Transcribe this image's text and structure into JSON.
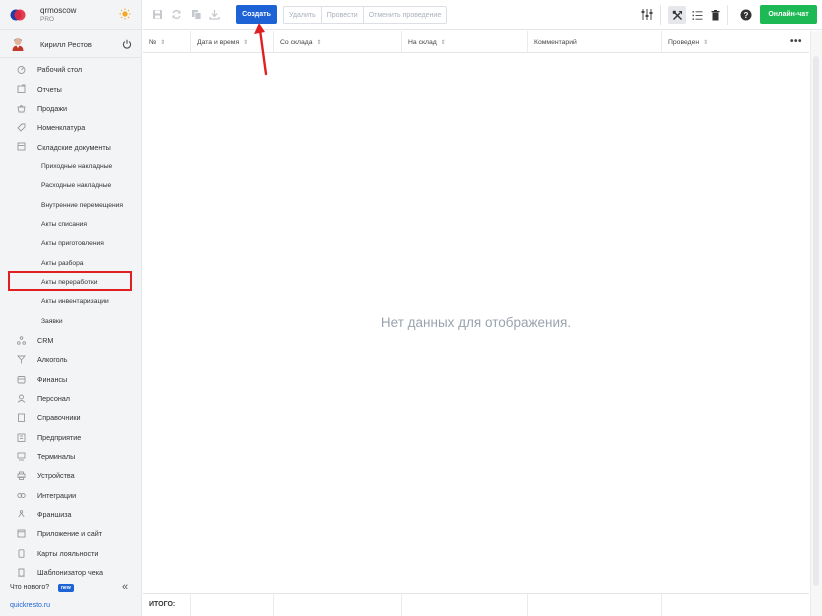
{
  "brand": {
    "name": "qrmoscow",
    "plan": "PRO"
  },
  "user": {
    "name": "Кирилл Рестов"
  },
  "nav": [
    {
      "label": "Рабочий стол",
      "icon": "dashboard-icon",
      "sub": false
    },
    {
      "label": "Отчеты",
      "icon": "reports-icon",
      "sub": false
    },
    {
      "label": "Продажи",
      "icon": "sales-icon",
      "sub": false
    },
    {
      "label": "Номенклатура",
      "icon": "tag-icon",
      "sub": false
    },
    {
      "label": "Складские документы",
      "icon": "warehouse-icon",
      "sub": false
    },
    {
      "label": "Приходные накладные",
      "sub": true
    },
    {
      "label": "Расходные накладные",
      "sub": true
    },
    {
      "label": "Внутренние перемещения",
      "sub": true
    },
    {
      "label": "Акты списания",
      "sub": true
    },
    {
      "label": "Акты приготовления",
      "sub": true
    },
    {
      "label": "Акты разбора",
      "sub": true
    },
    {
      "label": "Акты переработки",
      "sub": true,
      "active": true
    },
    {
      "label": "Акты инвентаризации",
      "sub": true
    },
    {
      "label": "Заявки",
      "sub": true
    },
    {
      "label": "CRM",
      "icon": "crm-icon",
      "sub": false
    },
    {
      "label": "Алкоголь",
      "icon": "alcohol-icon",
      "sub": false
    },
    {
      "label": "Финансы",
      "icon": "finance-icon",
      "sub": false
    },
    {
      "label": "Персонал",
      "icon": "staff-icon",
      "sub": false
    },
    {
      "label": "Справочники",
      "icon": "book-icon",
      "sub": false
    },
    {
      "label": "Предприятие",
      "icon": "building-icon",
      "sub": false
    },
    {
      "label": "Терминалы",
      "icon": "terminal-icon",
      "sub": false
    },
    {
      "label": "Устройства",
      "icon": "printer-icon",
      "sub": false
    },
    {
      "label": "Интеграции",
      "icon": "link-icon",
      "sub": false
    },
    {
      "label": "Франшиза",
      "icon": "franchise-icon",
      "sub": false
    },
    {
      "label": "Приложение и сайт",
      "icon": "app-icon",
      "sub": false
    },
    {
      "label": "Карты лояльности",
      "icon": "card-icon",
      "sub": false
    },
    {
      "label": "Шаблонизатор чека",
      "icon": "receipt-icon",
      "sub": false
    }
  ],
  "footer": {
    "whats_new": "Что нового?",
    "new_badge": "new",
    "collapse": "«",
    "site": "quickresto.ru"
  },
  "toolbar": {
    "create": "Создать",
    "delete": "Удалить",
    "post": "Провести",
    "unpost": "Отменить проведение",
    "chat": "Онлайн-чат"
  },
  "table": {
    "columns": [
      "№",
      "Дата и время",
      "Со склада",
      "На склад",
      "Комментарий",
      "Проведен"
    ],
    "empty": "Нет данных для отображения.",
    "total": "ИТОГО:"
  },
  "colors": {
    "accent": "#1e63d6",
    "chat": "#1db954",
    "highlight": "#e02020"
  }
}
